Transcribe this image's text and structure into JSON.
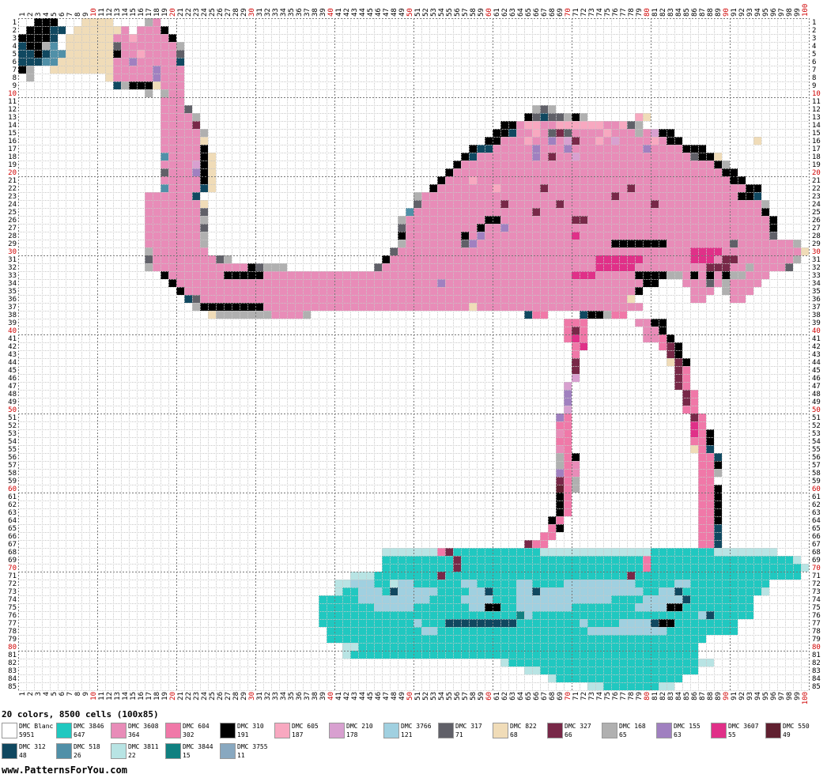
{
  "grid": {
    "cols": 100,
    "rows": 85
  },
  "summary": "20 colors, 8500 cells (100x85)",
  "footer": "www.PatternsForYou.com",
  "palette": [
    {
      "key": "W",
      "name": "DMC Blanc",
      "count": "5951",
      "color": "#ffffff"
    },
    {
      "key": "C",
      "name": "DMC 3846",
      "count": "647",
      "color": "#20c8c0"
    },
    {
      "key": "P",
      "name": "DMC 3608",
      "count": "364",
      "color": "#e88cb8"
    },
    {
      "key": "Q",
      "name": "DMC 604",
      "count": "302",
      "color": "#f078a8"
    },
    {
      "key": "K",
      "name": "DMC 310",
      "count": "191",
      "color": "#000000"
    },
    {
      "key": "L",
      "name": "DMC 605",
      "count": "187",
      "color": "#f8a8c0"
    },
    {
      "key": "V",
      "name": "DMC 210",
      "count": "178",
      "color": "#d8a0d0"
    },
    {
      "key": "B",
      "name": "DMC 3766",
      "count": "121",
      "color": "#a0d0e0"
    },
    {
      "key": "G",
      "name": "DMC 317",
      "count": "71",
      "color": "#606068"
    },
    {
      "key": "T",
      "name": "DMC 822",
      "count": "68",
      "color": "#f0dcb8"
    },
    {
      "key": "M",
      "name": "DMC 327",
      "count": "66",
      "color": "#782848"
    },
    {
      "key": "S",
      "name": "DMC 168",
      "count": "65",
      "color": "#b0b0b0"
    },
    {
      "key": "U",
      "name": "DMC 155",
      "count": "63",
      "color": "#a080c0"
    },
    {
      "key": "H",
      "name": "DMC 3607",
      "count": "55",
      "color": "#e03088"
    },
    {
      "key": "R",
      "name": "DMC 550",
      "count": "49",
      "color": "#602030"
    },
    {
      "key": "N",
      "name": "DMC 312",
      "count": "48",
      "color": "#104860"
    },
    {
      "key": "A",
      "name": "DMC 518",
      "count": "26",
      "color": "#5090a8"
    },
    {
      "key": "I",
      "name": "DMC 3811",
      "count": "22",
      "color": "#b8e4e4"
    },
    {
      "key": "E",
      "name": "DMC 3844",
      "count": "15",
      "color": "#108080"
    },
    {
      "key": "F",
      "name": "DMC 3755",
      "count": "11",
      "color": "#88a8c0"
    }
  ],
  "pattern": [
    "..KKK...TTTT....SP..............................................................................................",
    ".KKKNN.TTTTTTP.PPPK.................................................................................",
    "KKKKN.TTTTTTPPLPPPPK................................................................................",
    "NKKSA.TTTTTTGPPPPPPPS...............................................................................",
    "NNKNAATTTTTTKPPLPPPPG...............................................................................",
    "NNNAATTTTTTTPPUPPPPPN...............................................................................",
    "KS..TTTTTTTTPPPPPUPPP...............................................................................",
    ".S.........TPPPPPUPPP...............................................................................",
    "............NSKKKTPPP...............................................................................",
    "................S.SPP...............................................................................",
    "..................PPP...............................................................................",
    "..................PPPG...........................................SGS...............................",
    "..................PPPPS.........................................KGNGGSKS......LT.................",
    "..................PPPPM......................................KKPLLPPLLLLLLPPLGS...............",
    "..................PPPPPS....................................KKNPPLPGMGPPPPLPPPSPVKK..........",
    "..................PPPPPT...................................KKPPPLPPUPVMPPLPVPPPPLPKK.........T",
    "..................PPPPPK.................................KNNPPPPPUPPPUPPPPPPPPPUPPPPKKK....",
    "..................APPPPKT...............................KNPPPPPPPUPMPPVPPPPPPPPPPPPPPGKKT",
    "..................PPPPVKT..............................KPPPPPPPPPPPPPPPPPPPPPPPPPPPPPPPPKS",
    "..................GPPPUKT.............................KPPPPPPPPPPPPPPPPPPPPPPPPPPPPPPPPPPKK",
    "..................PPPPPKT............................KPPPLPPPPPPPPPPPPPPPPPPPPPPPPPPPPPPPPKK",
    "..................APPPPNT...........................KPPPPPPPLPPPPPMPPPPPPPPPPMPPPPPPPPPPPPPPKK",
    "................PPPPPPN...........................SPPPPPPPPPPPPPPPPPPPPPPPPMPPPPPPPPPPPPPPPKKN",
    "................PPPPPPPT..........................GPPPPPPPPPPMPPPPPPMPPPPPPPPPPPMPPPPPPPPPPPPPS",
    "................PPPPPPPG.........................APPPPPPPPPPPPPPPMPPPPPPPPPPPPPPPPPPPPPPPPPPPPK",
    "................PPPPPPPS........................SPPPPPPPPPPKKPPPPPPPPPMMPPPPPPPPPPPPPPPPPPPPPPPK",
    "................PPPPPPPG........................GPPPPPPPPPKPPUPPPPPPPPPPPPPPPPPPPPPPPPPPPPPPPPPK",
    "................PPPPPPPS........................KPPPPPPPKPUPPPPPPPPPPPHPPPPPPPPPPPPPPPPPPPPPPPPG",
    "................PPPPPPPS........................SPPPPPPPGUPPPPPPPPPPPPPPPPPKKKKKKKPPPPPPPPGPPPPPPPS",
    "................SPPPPPPP.......................GPPPPPPPPPPPPPPPPPPPPPPPPPPPPPPPPPPPPPHHHHPPPPPPPPPPT",
    "................GPPPPPPPPGS...................KPPPPPPPPPPPPPPPPPPPPPPPPPPHHHHHHPPPPPPHHHPMMPPPPPPPS",
    "................SPPPPPPPPPPPPKGSSS...........GPPPPPPPPPPPPPPPPPPPPPPPPPPPHHHHHPPPPPPPPPMMMPPSPPPPG",
    "..................KPPPPPPPKKKKKPPPPPPPPPPPPPPPPPPPPPPPPPPPPPPPPPPPPPPPHHHPPPPPKKKKSSPKPKPKSSPPP",
    "...................KPPPPPPPPPPPPPPPPPPPPPPPPPPPPPPPPPUPPPPPPPPPPPPPPPPPPPPPPPPPKK...PPPGPSPPPP",
    "....................KPPPPPPPPPPPPPPPPPPPPPPPPPPPPPPPPPPPPPPPPPPPPPPPPPPPPPPPPPK......PPP.SPPP",
    ".....................NGPPPPPPPPPPPPPPPPPPPPPPPPPPPPPPPPPPPPPPPPPPPPPPPPPPPPPPT.......PP...PP",
    "......................SKKKKKKKKPPPPPPPPPPPPPPPPPPPPPPPPPPTPPPPPPPPPPPPPPPPPPPPP.............",
    "........................TSSSSSSSPPPPS...........................NQQ....NKKSQQ.............",
    ".....................................................................QQQ......PPKK.........",
    ".....................................................................QMQ.......PPK.........",
    ".....................................................................QHQ.......PPQK........",
    "......................................................................QH.........QMK.......",
    "......................................................................Q...........MK.......",
    "......................................................................M...........TMK......",
    "......................................................................M............MQ......",
    "......................................................................V............MQ......",
    ".....................................................................V.............MQ......",
    ".....................................................................U..............MQ.....",
    ".....................................................................U..............MQ.....",
    ".....................................................................V..............QQ.....",
    "....................................................................UQ...............MQ....",
    "....................................................................QQ...............HQ....",
    "....................................................................PQ...............HQK...",
    "....................................................................QQ...............QQK...",
    "....................................................................PQ...............TQN...",
    "....................................................................SQK...............QQN...",
    "....................................................................SQP...............QQK...",
    "....................................................................UQP...............QQS...",
    "....................................................................MQS...............QQ....",
    "....................................................................RQS...............QQK...",
    "....................................................................KQ................QQK...",
    "....................................................................KQ................QQK...",
    "....................................................................KQ................QQK...",
    "...................................................................KQ.................QQK...",
    "...................................................................QK.................QQN...",
    "..................................................................QQ..................QQN...",
    "................................................................MQQ...................QQN...",
    "..............................................IIIIIIIQMCCCCCCCCCCCIIIIIIIIIIIIIICCCCCCCCIIIIIIII.",
    "..............................................CCCCCCCCCMCCCCCCCCCCCCCCCCCCCCCCCQCCCCCCCCCCCCCCCCCCI",
    "..............................................CCCCCCCCCMCCCCCCCCCCCCCCCCCCCCCCCQCCCCCCCCCCCCCCCCCCCII",
    "..........................................IIICCCCCCCCMCCCCCCCCCCCCCCCCCCCCCCCMCCCCCCCCCCCCCCCCCCCCC",
    "........................................IIBBBCCIBBCCCCCCBBCCCCCBBCCCCBBBBBBBBBCCCCCBBCCCCCCCCCC.",
    "........................................ICCBBBCNBBBBBCCCCBBNCCCBBNBBBBBBBBBBBBBCCBBNCCCCCCCCCCI.",
    "......................................CCCCCBBBBBBBBBCCCCBBBBCCCBBBBBBBBBBBBCCCCBBBBBNCCCCCCCC..",
    "......................................CCCCCCCBBBBBCCCCCCCBBKKCCBBBBBBBCCCCCCCCBBBBKKCCCCCCCCC..",
    "......................................CCCCCCCCCCCCCCCCCCCCCCCCCEBCCCCCCCCCCCCCCCCCCCCCBNCCCCC...",
    "......................................CCCCCCCCCCCCBCCCNNNNNNNNNCCCCCCCCBCCCCBBBBNKKCCCCCCCC....",
    ".......................................CCCCCCCCCCCCBBCCCCCCCCCCCCCCCCCCCBBBBBBBBBBCCCCCCCCC....",
    ".......................................CCCCCCCCCCCCCCCCCCCCCCCCCCCCCCCCCCCCCCCCCCCCCCCC.....",
    ".........................................IICCCCCCCCCCCCCCCCCCCCCCCCCCCCCCCCCCCCCCCCCCC.....",
    ".........................................ICCCCCCCCCCCCCCCCCCCCCCCCCCCCCCCCCCCCCCCCCCCC......",
    ".............................................................ICCCCCCCCCCCCCCCCCCCCCCCCII.........",
    "................................................................IICCCCCCCCCCCCCCCCCCCC..............",
    "...................................................................ICCCCCCCCCCCCCCCC................",
    "........................................................................IICCCCCCCII................."
  ]
}
